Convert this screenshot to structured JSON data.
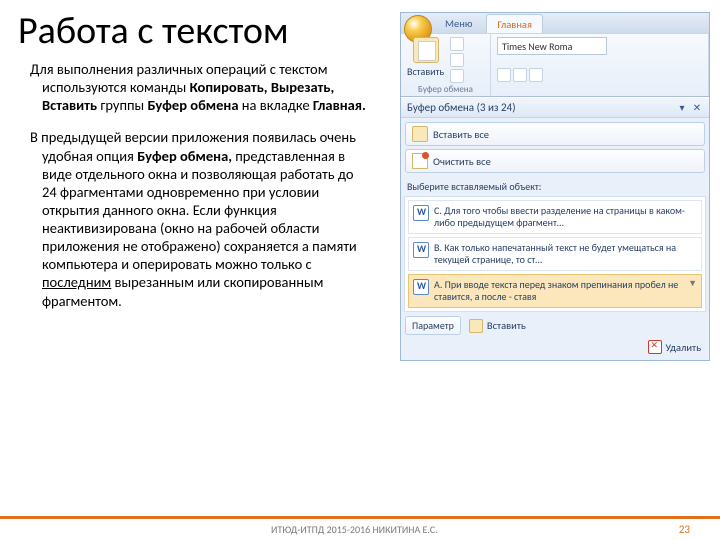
{
  "title": "Работа с текстом",
  "para1": {
    "t1": "Для выполнения различных операций с текстом используются команды ",
    "b1": "Копировать, Вырезать, Вставить",
    "t2": " группы ",
    "b2": "Буфер обмена",
    "t3": " на вкладке ",
    "b3": "Главная."
  },
  "para2": {
    "t1": "В предыдущей версии приложения появилась очень удобная опция ",
    "b1": "Буфер обмена,",
    "t2": " представленная в виде отдельного окна и позволяющая работать до 24 фрагментами одновременно при условии открытия данного окна. Если функция неактивизирована (окно на рабочей области приложения не отображено) сохраняется а памяти компьютера и оперировать можно только с ",
    "u1": "последним",
    "t3": " вырезанным или скопированным фрагментом."
  },
  "ribbon": {
    "tab_menu": "Меню",
    "tab_main": "Главная",
    "paste": "Вставить",
    "group_clip": "Буфер обмена",
    "font": "Times New Roma"
  },
  "pane": {
    "title": "Буфер обмена (3 из 24)",
    "paste_all": "Вставить все",
    "clear_all": "Очистить все",
    "hint": "Выберите вставляемый объект:",
    "clip_c": "C. Для того чтобы ввести разделение на страницы в каком-либо предыдущем фрагмент…",
    "clip_b": "B. Как только напечатанный текст не будет умещаться на текущей странице, то ст…",
    "clip_a": "A. При вводе текста перед знаком препинания пробел не ставится, а после - ставя",
    "params": "Параметр",
    "paste_one": "Вставить",
    "delete": "Удалить"
  },
  "footer": {
    "center": "ИТЮД-ИТПД 2015-2016    НИКИТИНА Е.С.",
    "page": "23"
  }
}
